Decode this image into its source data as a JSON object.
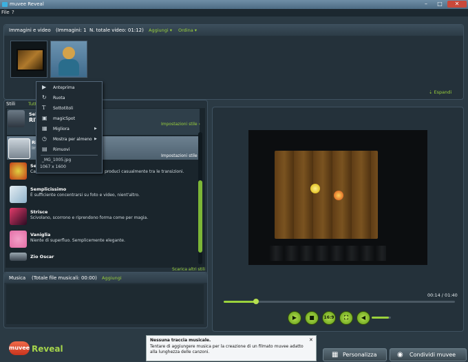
{
  "window": {
    "title": "muvee Reveal",
    "min": "–",
    "max": "□",
    "close": "✕"
  },
  "menu": {
    "file": "File",
    "help": "?"
  },
  "media": {
    "header": "Immagini e video",
    "counts": "(Immagini: 1",
    "total": "N. totale video: 01:12)",
    "add_label": "Aggiungi",
    "order_label": "Ordina",
    "expand_label": "Espandi"
  },
  "context_menu": {
    "items": [
      "Anteprima",
      "Ruota",
      "Sottotitoli",
      "magicSpot",
      "Migliora",
      "Mostra per almeno",
      "Rimuovi"
    ],
    "file_name": "_MG_1005.jpg",
    "dimensions": "1067 x 1600"
  },
  "styles": {
    "tab": "Stili",
    "all_tab": "Tutt",
    "settings_label": "Impostazioni stile",
    "settings_label_2": "Impostazioni stile",
    "partial_1_title": "Sel",
    "partial_1_sub": "RIT",
    "partial_2_title": "Ri",
    "partial_2_sub": "Im",
    "partial_3_title": "Se",
    "partial_3_desc": "Ca",
    "partial_3_desc_tail": "producì casualmente tra le transizioni.",
    "items": [
      {
        "title": "Semplicissimo",
        "desc": "È sufficiente concentrarsi su foto e video, nient'altro."
      },
      {
        "title": "Strisce",
        "desc": "Scivolano, scorrono e riprendono forma come per magia."
      },
      {
        "title": "Vaniglia",
        "desc": "Niente di superfluo. Semplicemente elegante."
      },
      {
        "title": "Zio Oscar",
        "desc": ""
      }
    ],
    "more_link": "Scarica altri stili"
  },
  "music": {
    "header": "Musica",
    "total": "(Totale file musicali: 00:00)",
    "add_label": "Aggiungi"
  },
  "player": {
    "time": "00:14 / 01:40",
    "progress": 0.14,
    "aspect_label": "16:9",
    "volume": 0.9
  },
  "notice": {
    "title": "Nessuna traccia musicale.",
    "body": "Tentare di aggiungere musica per la creazione di un filmato muvee adatto alla lunghezza delle canzoni.",
    "close": "✕"
  },
  "brand": {
    "muvee": "muvee",
    "reveal": "Reveal"
  },
  "buttons": {
    "personalize": "Personalizza",
    "share": "Condividi muvee"
  },
  "colors": {
    "accent": "#9bd23c",
    "background": "#2b3a44"
  }
}
